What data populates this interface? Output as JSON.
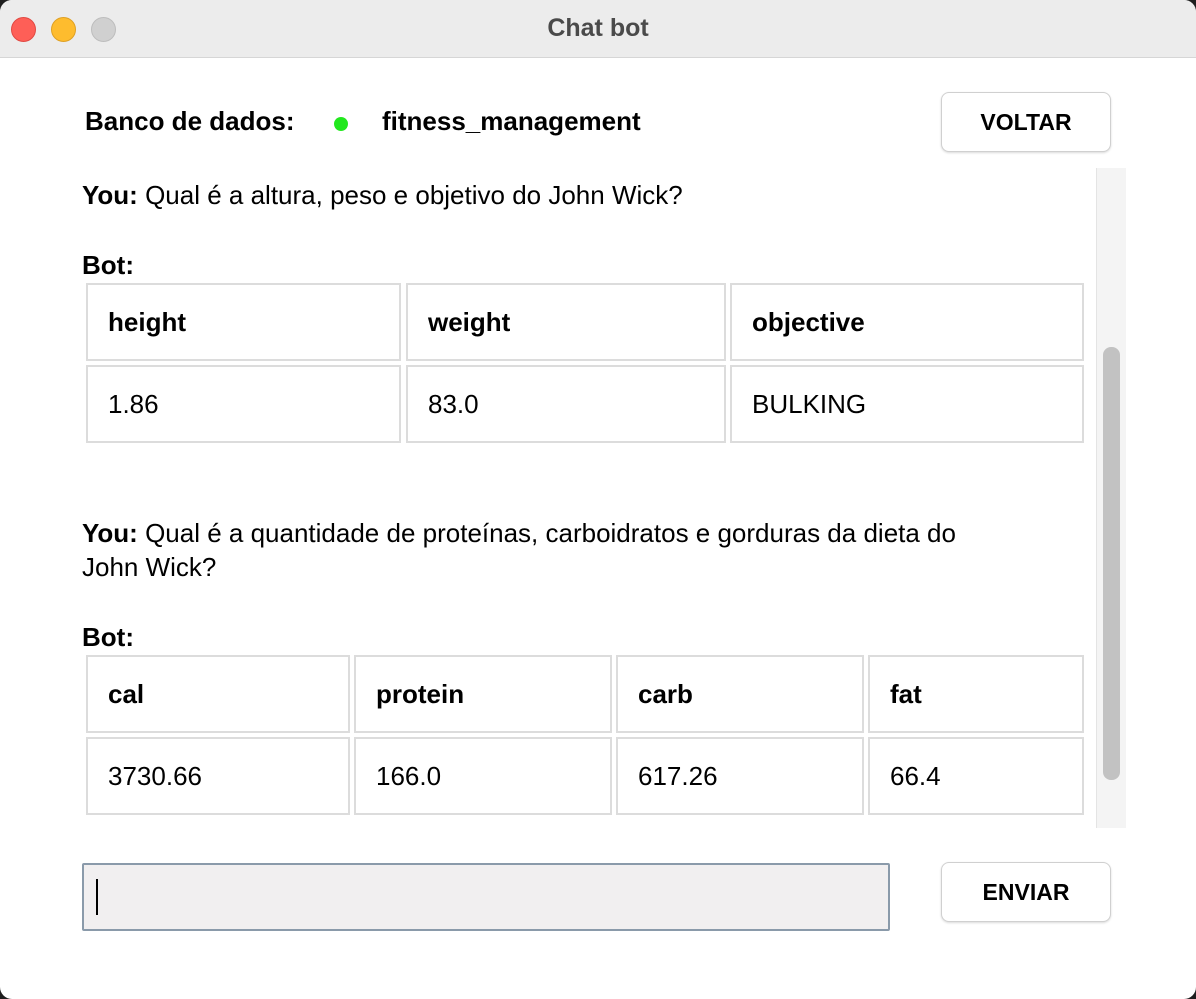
{
  "window": {
    "title": "Chat bot"
  },
  "header": {
    "db_label": "Banco de dados:",
    "db_status_color": "#22e81e",
    "db_name": "fitness_management",
    "back_button": "VOLTAR"
  },
  "conversation": [
    {
      "you_label": "You:",
      "question": "Qual é a altura, peso e objetivo do John Wick?",
      "bot_label": "Bot:",
      "table": {
        "headers": [
          "height",
          "weight",
          "objective"
        ],
        "rows": [
          [
            "1.86",
            "83.0",
            "BULKING"
          ]
        ]
      }
    },
    {
      "you_label": "You:",
      "question_line1": "Qual é a quantidade de proteínas, carboidratos e gorduras da dieta do",
      "question_line2": "John Wick?",
      "bot_label": "Bot:",
      "table": {
        "headers": [
          "cal",
          "protein",
          "carb",
          "fat"
        ],
        "rows": [
          [
            "3730.66",
            "166.0",
            "617.26",
            "66.4"
          ]
        ]
      }
    }
  ],
  "composer": {
    "input_value": "",
    "send_button": "ENVIAR"
  }
}
